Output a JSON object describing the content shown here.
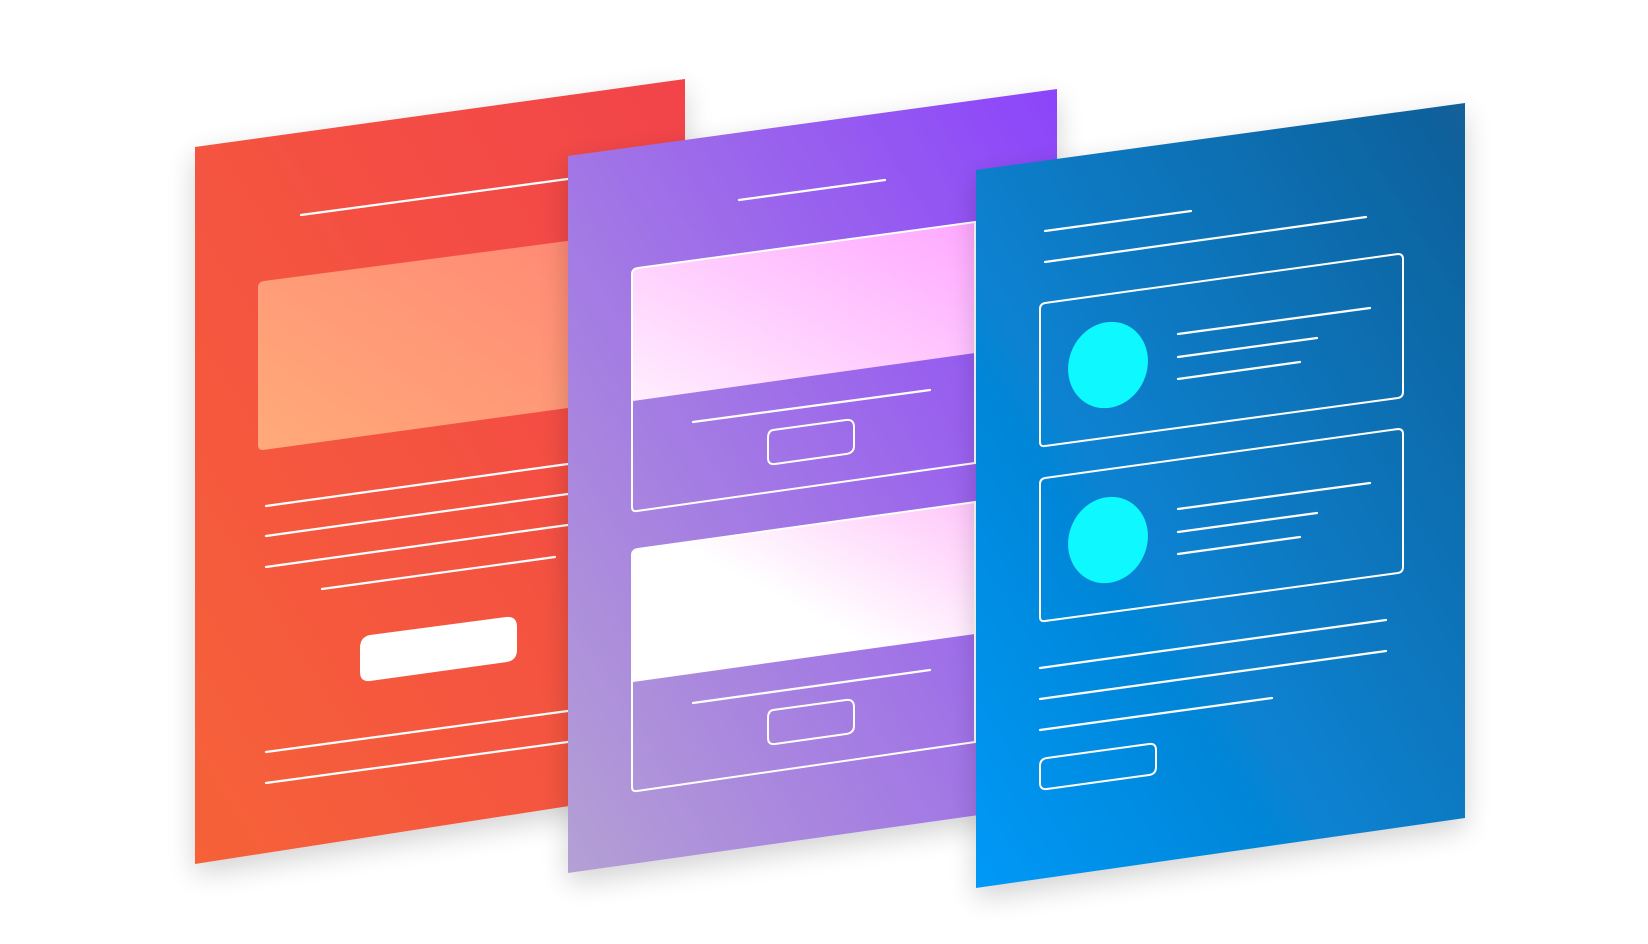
{
  "illustration": {
    "description_free": true,
    "cards": [
      {
        "id": "red",
        "gradient": [
          "#f66238",
          "#f2434a"
        ],
        "hero_gradient": [
          "#ffaa7a",
          "#ff8c74"
        ],
        "button_fill": "#ffffff",
        "line_color": "#ffffff"
      },
      {
        "id": "purple",
        "gradient": [
          "#b39ed6",
          "#8e45f8"
        ],
        "panel_gradient": [
          "#ffffff",
          "#ffb0ff"
        ],
        "line_color": "#ffffff"
      },
      {
        "id": "blue",
        "gradient": [
          "#0097f4",
          "#10609a"
        ],
        "avatar_color": "#10f8ff",
        "line_color": "#ffffff"
      }
    ],
    "shadow_color": "#e8e8f0"
  }
}
